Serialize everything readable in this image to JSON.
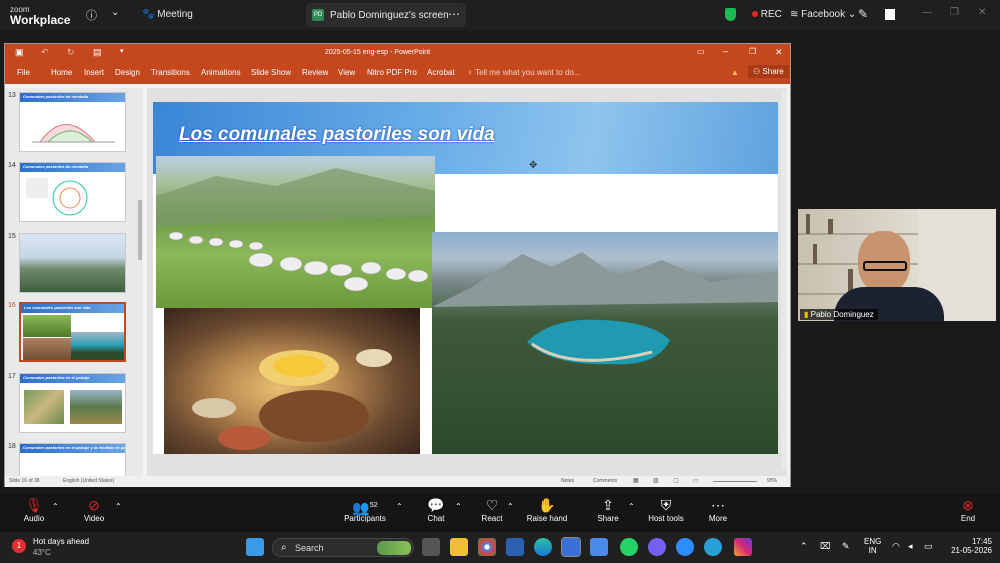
{
  "zoom": {
    "logo_small": "zoom",
    "logo_big": "Workplace",
    "meeting_label": "Meeting",
    "share_initials": "PD",
    "share_tab": "Pablo Dominguez's screen",
    "rec_label": "REC",
    "facebook_label": "Facebook"
  },
  "ppt": {
    "window_title": "2025-05-15 eng-esp - PowerPoint",
    "ribbon_tabs": [
      "File",
      "Home",
      "Insert",
      "Design",
      "Transitions",
      "Animations",
      "Slide Show",
      "Review",
      "View",
      "Nitro PDF Pro",
      "Acrobat"
    ],
    "tell_me": "Tell me what you want to do...",
    "share": "Share",
    "status_slide": "Slide 16 of 38",
    "status_lang": "English (United States)",
    "status_notes": "Notes",
    "status_comments": "Comments",
    "status_zoom": "95%"
  },
  "thumbnails": [
    {
      "num": "13",
      "title": "Comunales pastoriles de montaña"
    },
    {
      "num": "14",
      "title": "Comunales pastoriles de montaña"
    },
    {
      "num": "15",
      "title": ""
    },
    {
      "num": "16",
      "title": "Los comunales pastoriles son vida"
    },
    {
      "num": "17",
      "title": "Comunales pastoriles en el paisaje"
    },
    {
      "num": "18",
      "title": "Comunales pastoriles en el paisaje y la recibido en paisaje"
    }
  ],
  "slide": {
    "title": "Los comunales pastoriles son vida"
  },
  "participant": {
    "name": "Pablo Dominguez"
  },
  "toolbar": {
    "audio": "Audio",
    "video": "Video",
    "participants": "Participants",
    "participants_count": "52",
    "chat": "Chat",
    "react": "React",
    "raise_hand": "Raise hand",
    "share": "Share",
    "host_tools": "Host tools",
    "more": "More",
    "end": "End"
  },
  "taskbar": {
    "weather_title": "Hot days ahead",
    "weather_temp": "43°C",
    "search_placeholder": "Search",
    "lang_top": "ENG",
    "lang_bottom": "IN",
    "time": "17:45",
    "date": "21-05-2026"
  },
  "colors": {
    "ppt_accent": "#c5471e",
    "slide_title": "#1a3fb0",
    "end_red": "#e02828",
    "rec_green": "#1db954"
  }
}
